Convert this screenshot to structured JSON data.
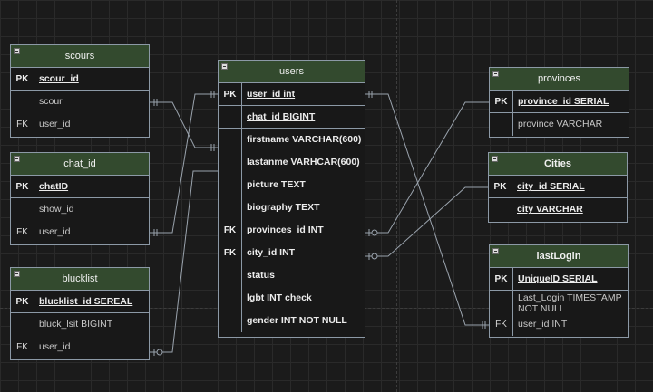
{
  "entities": {
    "scours": {
      "title": "scours",
      "rows": [
        {
          "key": "PK",
          "name": "scour_id"
        },
        {
          "key": "",
          "name": "scour"
        },
        {
          "key": "FK",
          "name": "user_id"
        }
      ]
    },
    "chat_id": {
      "title": "chat_id",
      "rows": [
        {
          "key": "PK",
          "name": "chatID"
        },
        {
          "key": "",
          "name": "show_id"
        },
        {
          "key": "FK",
          "name": "user_id"
        }
      ]
    },
    "blucklist": {
      "title": "blucklist",
      "rows": [
        {
          "key": "PK",
          "name": "blucklist_id SEREAL"
        },
        {
          "key": "",
          "name": "bluck_lsit  BIGINT"
        },
        {
          "key": "FK",
          "name": "user_id"
        }
      ]
    },
    "users": {
      "title": "users",
      "rows": [
        {
          "key": "PK",
          "name": "user_id int"
        },
        {
          "key": "",
          "name": "chat_id BIGINT"
        },
        {
          "key": "",
          "name": "firstname VARCHAR(600)"
        },
        {
          "key": "",
          "name": "lastanme VARHCAR(600)"
        },
        {
          "key": "",
          "name": "picture TEXT"
        },
        {
          "key": "",
          "name": "biography TEXT"
        },
        {
          "key": "FK",
          "name": "provinces_id INT"
        },
        {
          "key": "FK",
          "name": "city_id INT"
        },
        {
          "key": "",
          "name": "status"
        },
        {
          "key": "",
          "name": "lgbt INT check"
        },
        {
          "key": "",
          "name": "gender INT NOT NULL"
        }
      ]
    },
    "provinces": {
      "title": "provinces",
      "rows": [
        {
          "key": "PK",
          "name": "province_id SERIAL"
        },
        {
          "key": "",
          "name": "province VARCHAR"
        }
      ]
    },
    "cities": {
      "title": "Cities",
      "rows": [
        {
          "key": "PK",
          "name": "city_id SERIAL"
        },
        {
          "key": "",
          "name": "city VARCHAR"
        }
      ]
    },
    "lastlogin": {
      "title": "lastLogin",
      "rows": [
        {
          "key": "PK",
          "name": "UniqueID SERIAL"
        },
        {
          "key": "",
          "name": "Last_Login TIMESTAMP NOT NULL"
        },
        {
          "key": "FK",
          "name": "user_id  INT"
        }
      ]
    }
  },
  "colors": {
    "background": "#1b1b1b",
    "header": "#334a2e",
    "border": "#8c99a6",
    "line": "#9aa3ad"
  }
}
